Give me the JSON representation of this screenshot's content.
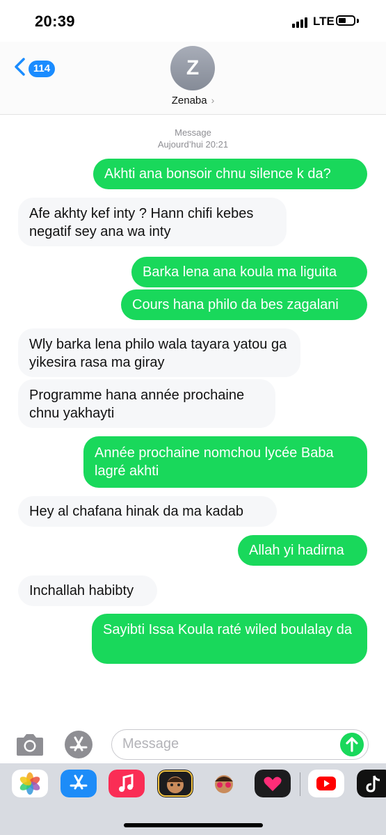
{
  "status": {
    "time": "20:39",
    "network": "LTE"
  },
  "header": {
    "back_count": "114",
    "avatar_initial": "Z",
    "contact_name": "Zenaba",
    "chevron": "›"
  },
  "thread": {
    "service": "Message",
    "timestamp": "Aujourd’hui 20:21"
  },
  "messages": [
    {
      "dir": "sent",
      "text": "Akhti ana bonsoir chnu silence k da?"
    },
    {
      "dir": "recv",
      "text": "Afe akhty kef inty ? Hann chifi kebes negatif sey ana wa inty"
    },
    {
      "dir": "sent",
      "text": "Barka lena ana koula ma liguita"
    },
    {
      "dir": "sent",
      "text": "Cours hana philo da bes zagalani"
    },
    {
      "dir": "recv",
      "text": "Wly barka lena philo wala tayara yatou ga yikesira rasa ma giray"
    },
    {
      "dir": "recv",
      "text": "Programme hana année prochaine chnu yakhayti"
    },
    {
      "dir": "sent",
      "text": "Année prochaine nomchou lycée Baba lagré akhti"
    },
    {
      "dir": "recv",
      "text": "Hey al chafana hinak da ma kadab"
    },
    {
      "dir": "sent",
      "text": "Allah yi hadirna"
    },
    {
      "dir": "recv",
      "text": "Inchallah habibty"
    },
    {
      "dir": "sent",
      "text": "Sayibti Issa Koula raté wiled boulalay da"
    }
  ],
  "input": {
    "placeholder": "Message"
  },
  "icons": {
    "camera": "camera-icon",
    "apps": "app-store-icon",
    "send": "arrow-up-icon",
    "drawer": [
      "photos-icon",
      "app-store-icon",
      "music-icon",
      "memoji-icon",
      "memoji-stickers-icon",
      "digital-touch-icon",
      "youtube-icon",
      "tiktok-icon"
    ]
  },
  "colors": {
    "sent_bubble": "#19d85b",
    "received_bubble": "#f6f7f9",
    "accent": "#1a8cff"
  }
}
